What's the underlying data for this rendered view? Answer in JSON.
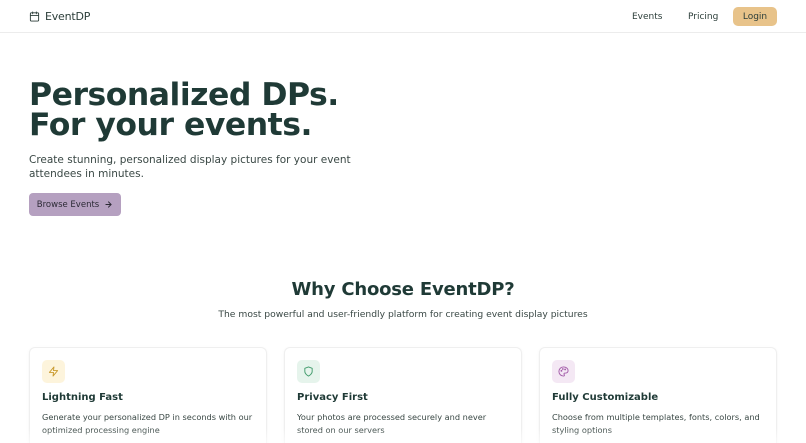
{
  "nav": {
    "brand": "EventDP",
    "links": [
      "Events",
      "Pricing"
    ],
    "login": "Login"
  },
  "hero": {
    "title_line1": "Personalized DPs.",
    "title_line2": "For your events.",
    "subtitle": "Create stunning, personalized display pictures for your event attendees in minutes.",
    "cta": "Browse Events"
  },
  "features": {
    "title": "Why Choose EventDP?",
    "subtitle": "The most powerful and user-friendly platform for creating event display pictures",
    "cards": [
      {
        "icon": "lightning-icon",
        "title": "Lightning Fast",
        "description": "Generate your personalized DP in seconds with our optimized processing engine"
      },
      {
        "icon": "shield-icon",
        "title": "Privacy First",
        "description": "Your photos are processed securely and never stored on our servers"
      },
      {
        "icon": "palette-icon",
        "title": "Fully Customizable",
        "description": "Choose from multiple templates, fonts, colors, and styling options"
      }
    ]
  },
  "colors": {
    "heading": "#1f3a36",
    "login_bg": "#e8c38a",
    "cta_bg": "#b5a0c0",
    "lightning_bg": "#fdf4dc",
    "shield_bg": "#e6f4ec",
    "palette_bg": "#f4e8f4"
  }
}
